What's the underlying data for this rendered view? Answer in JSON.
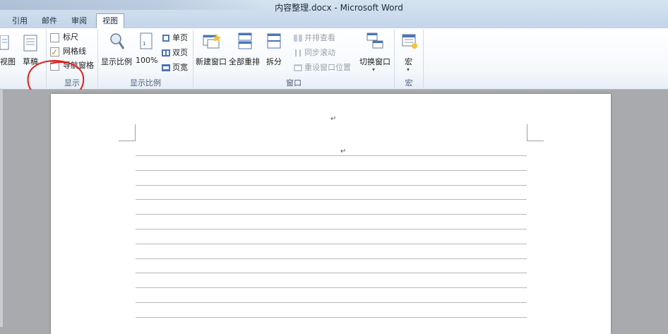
{
  "window": {
    "title": "内容整理.docx - Microsoft Word"
  },
  "tabs": [
    {
      "label": "引用",
      "active": false
    },
    {
      "label": "邮件",
      "active": false
    },
    {
      "label": "审阅",
      "active": false
    },
    {
      "label": "视图",
      "active": true
    }
  ],
  "ribbon": {
    "views_group": {
      "web_view_label": "视图",
      "draft_label": "草稿"
    },
    "show_group": {
      "label": "显示",
      "ruler": {
        "label": "标尺",
        "checked": false
      },
      "gridlines": {
        "label": "网格线",
        "checked": true
      },
      "nav_pane": {
        "label": "导航窗格",
        "checked": false
      }
    },
    "zoom_group": {
      "label": "显示比例",
      "zoom_label": "显示比例",
      "percent_label": "100%",
      "one_page": "单页",
      "two_pages": "双页",
      "page_width": "页宽"
    },
    "window_group": {
      "label": "窗口",
      "new_window": "新建窗口",
      "arrange_all": "全部重排",
      "split": "拆分",
      "side_by_side": "并排查看",
      "sync_scroll": "同步滚动",
      "reset_position": "重设窗口位置",
      "switch_windows": "切换窗口",
      "switch_arrow": "▾"
    },
    "macros_group": {
      "label": "宏",
      "macros": "宏",
      "macros_arrow": "▾"
    }
  },
  "document": {
    "paragraph_mark": "↵",
    "gridline_count": 12
  },
  "colors": {
    "accent_tab": "#ffffff",
    "annotation": "#e0201c",
    "checkbox_tick": "#c48a00"
  }
}
